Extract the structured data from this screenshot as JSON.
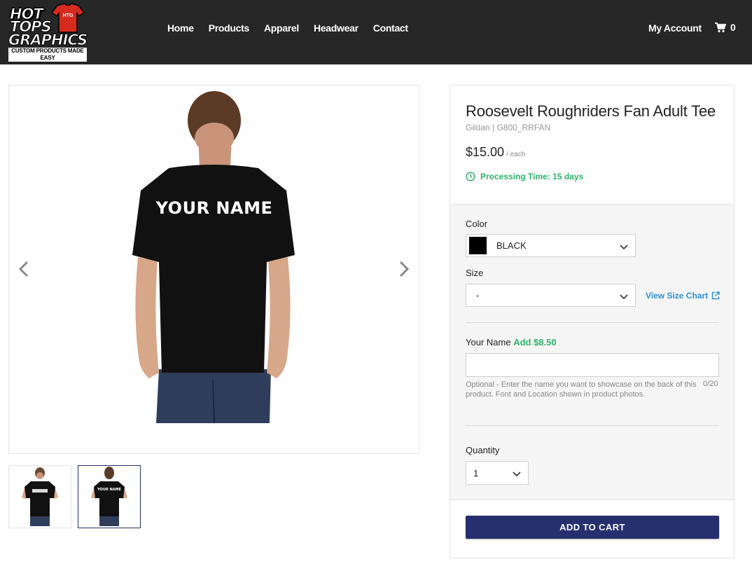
{
  "header": {
    "logo": {
      "line1": "HOT",
      "line2": "TOPS",
      "line3": "GRAPHICS",
      "tagline": "CUSTOM PRODUCTS MADE EASY",
      "shirt_mark": "HTG"
    },
    "nav": [
      "Home",
      "Products",
      "Apparel",
      "Headwear",
      "Contact"
    ],
    "account_label": "My Account",
    "cart_count": "0"
  },
  "gallery": {
    "main_image_text": "YOUR NAME",
    "thumb2_text": "YOUR NAME",
    "prev_icon": "chevron-left-icon",
    "next_icon": "chevron-right-icon"
  },
  "product": {
    "title": "Roosevelt Roughriders Fan Adult Tee",
    "subtitle": "Gildan | G800_RRFAN",
    "price": "$15.00",
    "price_unit": "/ each",
    "processing": "Processing Time: 15 days",
    "color_label": "Color",
    "color_value": "BLACK",
    "size_label": "Size",
    "size_value": "-",
    "size_chart_label": "View Size Chart",
    "name_label": "Your Name",
    "name_add": "Add $8.50",
    "name_help": "Optional - Enter the name you want to showcase on the back of this product. Font and Location shown in product photos.",
    "name_counter": "0/20",
    "quantity_label": "Quantity",
    "quantity_value": "1",
    "add_to_cart": "ADD TO CART"
  },
  "colors": {
    "header_bg": "#262626",
    "accent_navy": "#26306f",
    "green": "#2fb36a",
    "link_blue": "#2d8fd6"
  }
}
